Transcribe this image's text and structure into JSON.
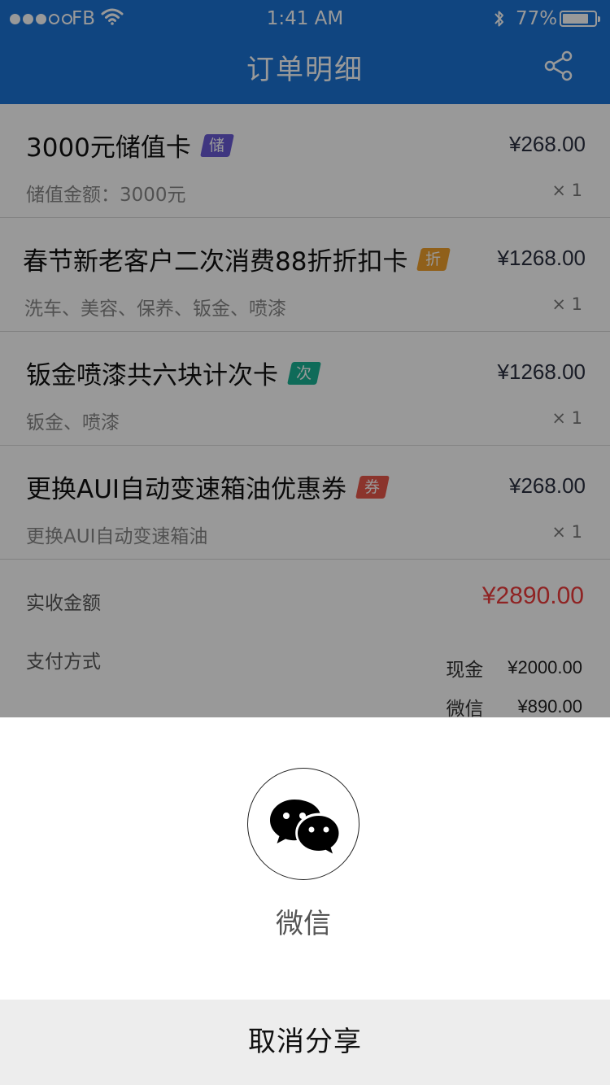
{
  "status_bar": {
    "carrier": "FB",
    "time": "1:41 AM",
    "battery": "77%",
    "battery_level": 0.77
  },
  "header": {
    "title": "订单明细",
    "bg_color": "#1b73d6"
  },
  "order_items": [
    {
      "name": "3000元储值卡",
      "tag": "储",
      "tag_color": "#6a5bd6",
      "price": "¥268.00",
      "desc": "储值金额：3000元",
      "qty": "× 1"
    },
    {
      "name": "春节新老客户二次消费88折折扣卡",
      "tag": "折",
      "tag_color": "#f0a02c",
      "price": "¥1268.00",
      "desc": "洗车、美容、保养、钣金、喷漆",
      "qty": "× 1"
    },
    {
      "name": "钣金喷漆共六块计次卡",
      "tag": "次",
      "tag_color": "#1ab394",
      "price": "¥1268.00",
      "desc": "钣金、喷漆",
      "qty": "× 1"
    },
    {
      "name": "更换AUI自动变速箱油优惠券",
      "tag": "券",
      "tag_color": "#e8584a",
      "price": "¥268.00",
      "desc": "更换AUI自动变速箱油",
      "qty": "× 1"
    }
  ],
  "summary": {
    "received_label": "实收金额",
    "received_amount": "¥2890.00",
    "received_color": "#ef3b3b",
    "payment_label": "支付方式",
    "payments": [
      {
        "method": "现金",
        "amount": "¥2000.00"
      },
      {
        "method": "微信",
        "amount": "¥890.00"
      }
    ]
  },
  "share_sheet": {
    "option_label": "微信",
    "option_icon": "wechat-icon",
    "cancel_label": "取消分享"
  }
}
